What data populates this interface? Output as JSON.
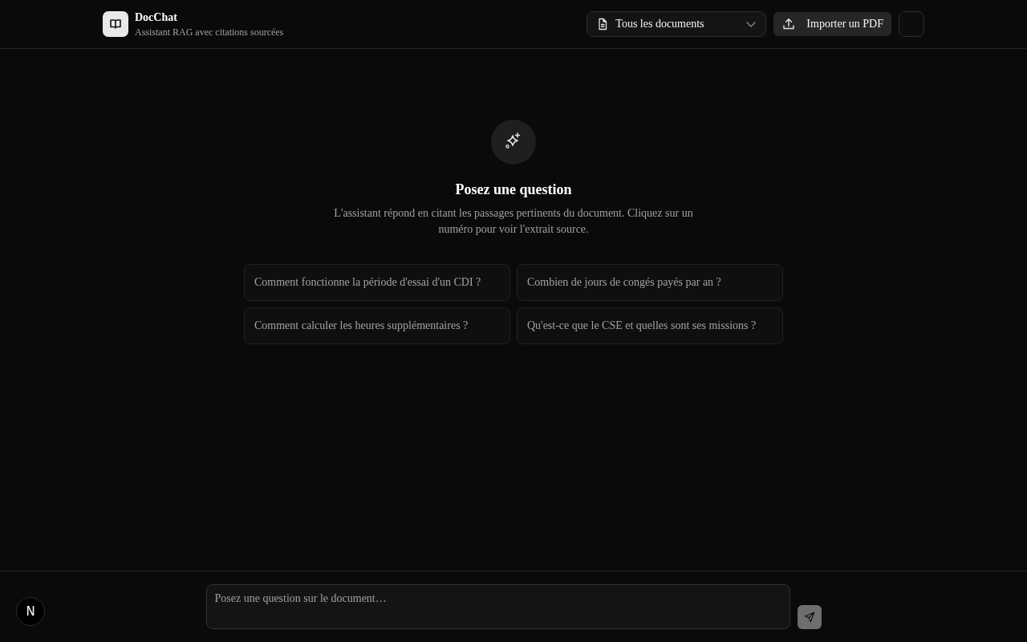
{
  "header": {
    "app_name": "DocChat",
    "tagline": "Assistant RAG avec citations sourcées",
    "document_select": {
      "value": "Tous les documents"
    },
    "import_button": {
      "label": "Importer un PDF"
    }
  },
  "empty_state": {
    "title": "Posez une question",
    "description": "L'assistant répond en citant les passages pertinents du document. Cliquez sur un numéro pour voir l'extrait source.",
    "suggestions": [
      "Comment fonctionne la période d'essai d'un CDI ?",
      "Combien de jours de congés payés par an ?",
      "Comment calculer les heures supplémentaires ?",
      "Qu'est-ce que le CSE et quelles sont ses missions ?"
    ]
  },
  "composer": {
    "placeholder": "Posez une question sur le document…",
    "send_button": {
      "disabled": true
    }
  },
  "dev_badge": {
    "label": "N"
  }
}
